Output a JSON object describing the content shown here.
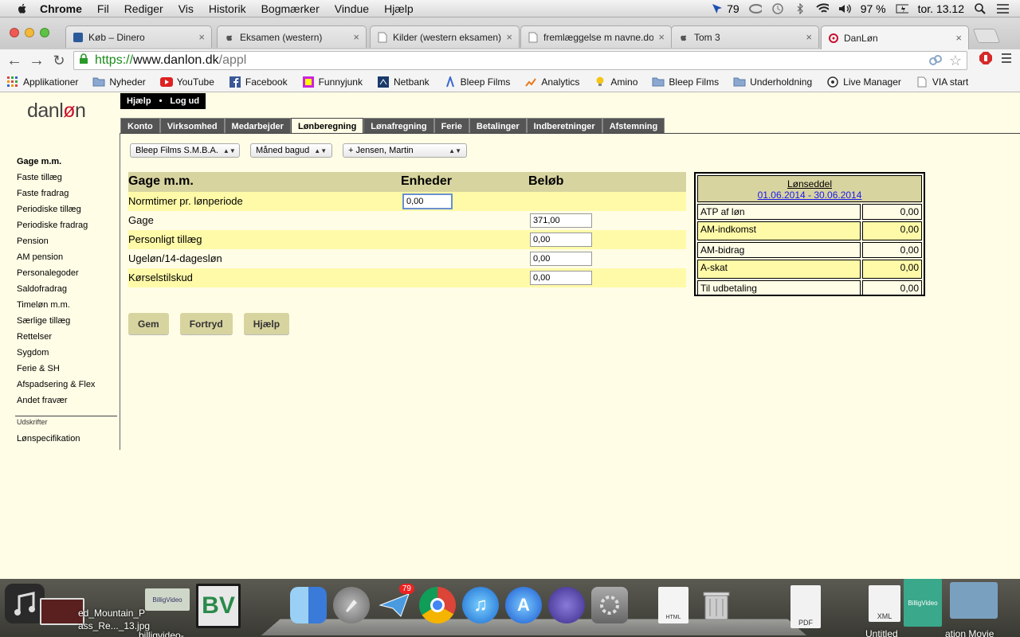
{
  "menubar": {
    "app": "Chrome",
    "items": [
      "Fil",
      "Rediger",
      "Vis",
      "Historik",
      "Bogmærker",
      "Vindue",
      "Hjælp"
    ],
    "status": {
      "notify_count": "79",
      "battery": "97 %",
      "clock": "tor. 13.12"
    }
  },
  "tabs": [
    {
      "title": "Køb – Dinero",
      "favicon": "dinero-icon"
    },
    {
      "title": "Eksamen (western)",
      "favicon": "apple-icon"
    },
    {
      "title": "Kilder (western eksamen)",
      "favicon": "document-icon"
    },
    {
      "title": "fremlæggelse m navne.docx",
      "favicon": "document-icon"
    },
    {
      "title": "Tom 3",
      "favicon": "apple-icon"
    },
    {
      "title": "DanLøn",
      "favicon": "danlon-icon",
      "active": true
    }
  ],
  "address": {
    "scheme": "https://",
    "host": "www.danlon.dk",
    "path": "/appl"
  },
  "bookmarks": [
    "Applikationer",
    "Nyheder",
    "YouTube",
    "Facebook",
    "Funnyjunk",
    "Netbank",
    "Bleep Films",
    "Analytics",
    "Amino",
    "Bleep Films",
    "Underholdning",
    "Live Manager",
    "VIA start"
  ],
  "app": {
    "logo_pre": "danl",
    "logo_o": "ø",
    "logo_post": "n",
    "top_links": [
      "Hjælp",
      "Log ud"
    ],
    "nav_tabs": [
      "Konto",
      "Virksomhed",
      "Medarbejder",
      "Lønberegning",
      "Lønafregning",
      "Ferie",
      "Betalinger",
      "Indberetninger",
      "Afstemning"
    ],
    "active_tab": "Lønberegning",
    "sidebar": [
      "Gage m.m.",
      "Faste tillæg",
      "Faste fradrag",
      "Periodiske tillæg",
      "Periodiske fradrag",
      "Pension",
      "AM pension",
      "Personalegoder",
      "Saldofradrag",
      "Timeløn m.m.",
      "Særlige tillæg",
      "Rettelser",
      "Sygdom",
      "Ferie & SH",
      "Afspadsering & Flex",
      "Andet fravær"
    ],
    "sidebar_section": "Udskrifter",
    "sidebar_after": [
      "Lønspecifikation"
    ],
    "selects": {
      "company": "Bleep Films S.M.B.A.",
      "period": "Måned bagud",
      "employee": "+ Jensen, Martin"
    },
    "form": {
      "headers": [
        "Gage m.m.",
        "Enheder",
        "Beløb"
      ],
      "rows": [
        {
          "label": "Normtimer pr. lønperiode",
          "units": "0,00",
          "amount": null
        },
        {
          "label": "Gage",
          "units": null,
          "amount": "371,00"
        },
        {
          "label": "Personligt tillæg",
          "units": null,
          "amount": "0,00"
        },
        {
          "label": "Ugeløn/14-dagesløn",
          "units": null,
          "amount": "0,00"
        },
        {
          "label": "Kørselstilskud",
          "units": null,
          "amount": "0,00"
        }
      ]
    },
    "buttons": [
      "Gem",
      "Fortryd",
      "Hjælp"
    ],
    "payslip": {
      "title": "Lønseddel",
      "period": "01.06.2014 - 30.06.2014",
      "rows": [
        {
          "label": "ATP af løn",
          "value": "0,00"
        },
        {
          "label": "AM-indkomst",
          "value": "0,00"
        },
        {
          "label": "AM-bidrag",
          "value": "0,00"
        },
        {
          "label": "A-skat",
          "value": "0,00"
        },
        {
          "label": "Til udbetaling",
          "value": "0,00"
        }
      ]
    }
  },
  "dock": {
    "labels": [
      "ed_Mountain_P",
      "ass_Re..._13.jpg",
      "billigvideo-",
      "HTML",
      "PDF",
      "XML",
      "Untitled",
      "ation Movie"
    ],
    "mail_badge": "79"
  }
}
